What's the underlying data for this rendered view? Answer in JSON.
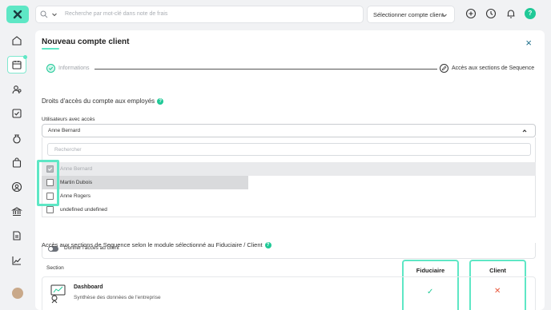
{
  "topbar": {
    "search_placeholder": "Recherche par mot-clé dans note de frais",
    "client_select": "Sélectionner compte client",
    "help": "?"
  },
  "modal": {
    "title": "Nouveau compte client",
    "close": "×",
    "steps": [
      {
        "label": "Informations"
      },
      {
        "label": "Accès aux sections de Sequence"
      }
    ]
  },
  "access": {
    "heading": "Droits d'accès du compte aux employés",
    "field_label": "Utilisateurs avec accès",
    "selected_value": "Anne Bernard",
    "search_placeholder": "Rechercher",
    "options": [
      {
        "label": "Anne Bernard",
        "checked": true
      },
      {
        "label": "Martin Dubois",
        "checked": false
      },
      {
        "label": "Anne Rogers",
        "checked": false
      },
      {
        "label": "undefined undefined",
        "checked": false
      }
    ],
    "client_toggle_label": "Donner l'accès au client"
  },
  "sections": {
    "heading": "Accès aux sections de Sequence selon le module sélectionné au Fiduciaire / Client",
    "col_section": "Section",
    "col_fiduciaire": "Fiduciaire",
    "col_client": "Client",
    "rows": [
      {
        "name": "Dashboard",
        "description": "Synthèse des données de l'entreprise",
        "fiduciaire": "✓",
        "client": "✕"
      }
    ]
  },
  "colors": {
    "accent": "#5ee7c5",
    "success": "#20c997",
    "danger": "#e8573c"
  }
}
